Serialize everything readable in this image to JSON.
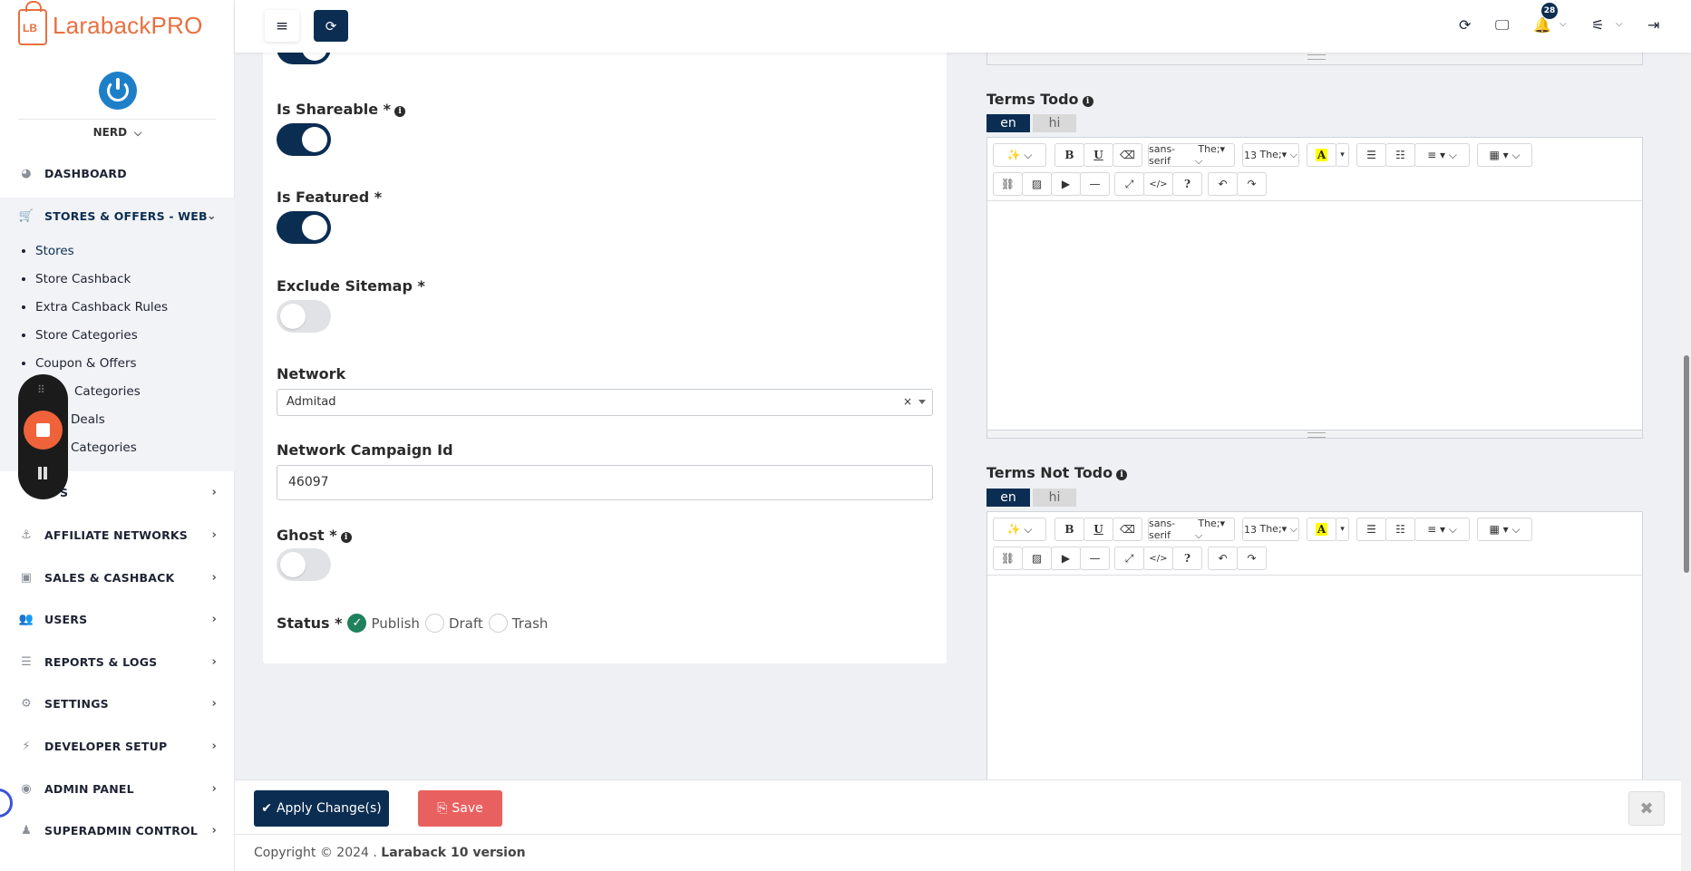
{
  "app": {
    "brand": "LarabackPRO",
    "logo_initials": "LB"
  },
  "user": {
    "name": "NERD"
  },
  "sidebar": {
    "items": [
      {
        "label": "DASHBOARD",
        "icon": "dashboard-icon"
      },
      {
        "label": "STORES & OFFERS - WEB",
        "icon": "cart-icon"
      },
      {
        "label": "S",
        "icon": "tags-icon"
      },
      {
        "label": "AFFILIATE NETWORKS",
        "icon": "anchor-icon"
      },
      {
        "label": "SALES & CASHBACK",
        "icon": "money-icon"
      },
      {
        "label": "USERS",
        "icon": "users-icon"
      },
      {
        "label": "REPORTS & LOGS",
        "icon": "list-icon"
      },
      {
        "label": "SETTINGS",
        "icon": "gears-icon"
      },
      {
        "label": "DEVELOPER SETUP",
        "icon": "plug-icon"
      },
      {
        "label": "ADMIN PANEL",
        "icon": "admin-icon"
      },
      {
        "label": "SUPERADMIN CONTROL",
        "icon": "superadmin-icon"
      }
    ],
    "sub_items": [
      "Stores",
      "Store Cashback",
      "Extra Cashback Rules",
      "Store Categories",
      "Coupon & Offers",
      "Categories",
      "Deals",
      "Categories"
    ]
  },
  "topbar": {
    "notification_count": "28"
  },
  "form": {
    "is_shareable": {
      "label": "Is Shareable *",
      "value": true
    },
    "is_featured": {
      "label": "Is Featured *",
      "value": true
    },
    "exclude_sitemap": {
      "label": "Exclude Sitemap *",
      "value": false
    },
    "network": {
      "label": "Network",
      "value": "Admitad",
      "clear": "×"
    },
    "network_campaign_id": {
      "label": "Network Campaign Id",
      "value": "46097"
    },
    "ghost": {
      "label": "Ghost *",
      "value": false
    },
    "status": {
      "label": "Status *",
      "options": [
        "Publish",
        "Draft",
        "Trash"
      ],
      "selected": "Publish"
    }
  },
  "editors": {
    "terms_todo": {
      "label": "Terms Todo",
      "tabs": [
        "en",
        "hi"
      ]
    },
    "terms_not_todo": {
      "label": "Terms Not Todo",
      "tabs": [
        "en",
        "hi"
      ]
    },
    "toolbar": {
      "font": "sans-serif",
      "size": "13"
    }
  },
  "actions": {
    "apply": "Apply Change(s)",
    "save": "Save"
  },
  "footer": {
    "copyright": "Copyright © 2024 .",
    "brand": "Laraback 10 version"
  }
}
